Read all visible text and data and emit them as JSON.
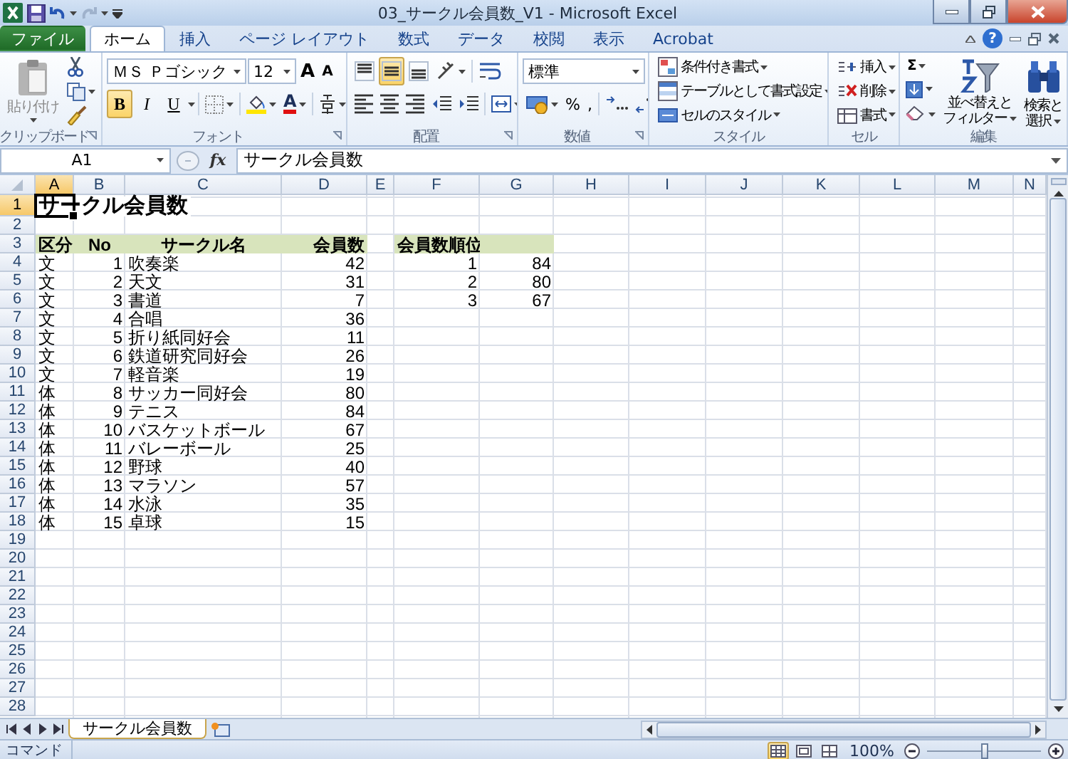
{
  "window": {
    "title": "03_サークル会員数_V1 - Microsoft Excel",
    "help": "?"
  },
  "ribbon_tabs": [
    {
      "label": "ファイル",
      "kind": "file",
      "selected": false
    },
    {
      "label": "ホーム",
      "kind": "tab",
      "selected": true
    },
    {
      "label": "挿入",
      "kind": "tab",
      "selected": false
    },
    {
      "label": "ページ レイアウト",
      "kind": "tab",
      "selected": false
    },
    {
      "label": "数式",
      "kind": "tab",
      "selected": false
    },
    {
      "label": "データ",
      "kind": "tab",
      "selected": false
    },
    {
      "label": "校閲",
      "kind": "tab",
      "selected": false
    },
    {
      "label": "表示",
      "kind": "tab",
      "selected": false
    },
    {
      "label": "Acrobat",
      "kind": "tab",
      "selected": false
    }
  ],
  "ribbon": {
    "clipboard": {
      "label": "クリップボード",
      "paste": "貼り付け"
    },
    "font": {
      "label": "フォント",
      "font_name": "ＭＳ Ｐゴシック",
      "font_size": "12",
      "grow": "A",
      "shrink": "A",
      "font_color": "A",
      "toggles": [
        {
          "label": "B",
          "on": true
        },
        {
          "label": "I",
          "on": false
        },
        {
          "label": "U",
          "on": false
        }
      ]
    },
    "alignment": {
      "label": "配置",
      "vertical": [
        {
          "on": false
        },
        {
          "on": true
        },
        {
          "on": false
        }
      ]
    },
    "number": {
      "label": "数値",
      "format": "標準",
      "percent": "%",
      "comma": ","
    },
    "styles": {
      "label": "スタイル",
      "items": [
        "条件付き書式",
        "テーブルとして書式設定",
        "セルのスタイル"
      ]
    },
    "cells": {
      "label": "セル",
      "items": [
        "挿入",
        "削除",
        "書式"
      ]
    },
    "editing": {
      "label": "編集",
      "sum": "Σ",
      "sort_filter": [
        "並べ替えと",
        "フィルター"
      ],
      "find_select": [
        "検索と",
        "選択"
      ]
    }
  },
  "formula_bar": {
    "name_box": "A1",
    "function_label": "fx",
    "formula": "サークル会員数"
  },
  "sheet": {
    "columns": [
      {
        "label": "A",
        "selected": true
      },
      {
        "label": "B",
        "selected": false
      },
      {
        "label": "C",
        "selected": false
      },
      {
        "label": "D",
        "selected": false
      },
      {
        "label": "E",
        "selected": false
      },
      {
        "label": "F",
        "selected": false
      },
      {
        "label": "G",
        "selected": false
      },
      {
        "label": "H",
        "selected": false
      },
      {
        "label": "I",
        "selected": false
      },
      {
        "label": "J",
        "selected": false
      },
      {
        "label": "K",
        "selected": false
      },
      {
        "label": "L",
        "selected": false
      },
      {
        "label": "M",
        "selected": false
      },
      {
        "label": "N",
        "selected": false
      }
    ],
    "rows": [
      {
        "label": "1",
        "selected": true,
        "cells": [
          {
            "text": "サークル会員数",
            "kind": "title",
            "active": true
          }
        ]
      },
      {
        "label": "2",
        "selected": false
      },
      {
        "label": "3",
        "selected": false,
        "cells": [
          {
            "text": "区分",
            "kind": "header"
          },
          {
            "text": "No",
            "kind": "header"
          },
          {
            "text": "サークル名",
            "kind": "header"
          },
          {
            "text": "会員数",
            "kind": "header"
          },
          null,
          {
            "text": "会員数順位",
            "kind": "header"
          },
          {
            "kind": "header"
          }
        ]
      },
      {
        "label": "4",
        "selected": false,
        "cells": [
          {
            "text": "文",
            "kind": "text"
          },
          {
            "text": "1",
            "kind": "number"
          },
          {
            "text": "吹奏楽",
            "kind": "text"
          },
          {
            "text": "42",
            "kind": "number"
          },
          null,
          {
            "text": "1",
            "kind": "number"
          },
          {
            "text": "84",
            "kind": "number"
          }
        ]
      },
      {
        "label": "5",
        "selected": false,
        "cells": [
          {
            "text": "文",
            "kind": "text"
          },
          {
            "text": "2",
            "kind": "number"
          },
          {
            "text": "天文",
            "kind": "text"
          },
          {
            "text": "31",
            "kind": "number"
          },
          null,
          {
            "text": "2",
            "kind": "number"
          },
          {
            "text": "80",
            "kind": "number"
          }
        ]
      },
      {
        "label": "6",
        "selected": false,
        "cells": [
          {
            "text": "文",
            "kind": "text"
          },
          {
            "text": "3",
            "kind": "number"
          },
          {
            "text": "書道",
            "kind": "text"
          },
          {
            "text": "7",
            "kind": "number"
          },
          null,
          {
            "text": "3",
            "kind": "number"
          },
          {
            "text": "67",
            "kind": "number"
          }
        ]
      },
      {
        "label": "7",
        "selected": false,
        "cells": [
          {
            "text": "文",
            "kind": "text"
          },
          {
            "text": "4",
            "kind": "number"
          },
          {
            "text": "合唱",
            "kind": "text"
          },
          {
            "text": "36",
            "kind": "number"
          }
        ]
      },
      {
        "label": "8",
        "selected": false,
        "cells": [
          {
            "text": "文",
            "kind": "text"
          },
          {
            "text": "5",
            "kind": "number"
          },
          {
            "text": "折り紙同好会",
            "kind": "text"
          },
          {
            "text": "11",
            "kind": "number"
          }
        ]
      },
      {
        "label": "9",
        "selected": false,
        "cells": [
          {
            "text": "文",
            "kind": "text"
          },
          {
            "text": "6",
            "kind": "number"
          },
          {
            "text": "鉄道研究同好会",
            "kind": "text"
          },
          {
            "text": "26",
            "kind": "number"
          }
        ]
      },
      {
        "label": "10",
        "selected": false,
        "cells": [
          {
            "text": "文",
            "kind": "text"
          },
          {
            "text": "7",
            "kind": "number"
          },
          {
            "text": "軽音楽",
            "kind": "text"
          },
          {
            "text": "19",
            "kind": "number"
          }
        ]
      },
      {
        "label": "11",
        "selected": false,
        "cells": [
          {
            "text": "体",
            "kind": "text"
          },
          {
            "text": "8",
            "kind": "number"
          },
          {
            "text": "サッカー同好会",
            "kind": "text"
          },
          {
            "text": "80",
            "kind": "number"
          }
        ]
      },
      {
        "label": "12",
        "selected": false,
        "cells": [
          {
            "text": "体",
            "kind": "text"
          },
          {
            "text": "9",
            "kind": "number"
          },
          {
            "text": "テニス",
            "kind": "text"
          },
          {
            "text": "84",
            "kind": "number"
          }
        ]
      },
      {
        "label": "13",
        "selected": false,
        "cells": [
          {
            "text": "体",
            "kind": "text"
          },
          {
            "text": "10",
            "kind": "number"
          },
          {
            "text": "バスケットボール",
            "kind": "text"
          },
          {
            "text": "67",
            "kind": "number"
          }
        ]
      },
      {
        "label": "14",
        "selected": false,
        "cells": [
          {
            "text": "体",
            "kind": "text"
          },
          {
            "text": "11",
            "kind": "number"
          },
          {
            "text": "バレーボール",
            "kind": "text"
          },
          {
            "text": "25",
            "kind": "number"
          }
        ]
      },
      {
        "label": "15",
        "selected": false,
        "cells": [
          {
            "text": "体",
            "kind": "text"
          },
          {
            "text": "12",
            "kind": "number"
          },
          {
            "text": "野球",
            "kind": "text"
          },
          {
            "text": "40",
            "kind": "number"
          }
        ]
      },
      {
        "label": "16",
        "selected": false,
        "cells": [
          {
            "text": "体",
            "kind": "text"
          },
          {
            "text": "13",
            "kind": "number"
          },
          {
            "text": "マラソン",
            "kind": "text"
          },
          {
            "text": "57",
            "kind": "number"
          }
        ]
      },
      {
        "label": "17",
        "selected": false,
        "cells": [
          {
            "text": "体",
            "kind": "text"
          },
          {
            "text": "14",
            "kind": "number"
          },
          {
            "text": "水泳",
            "kind": "text"
          },
          {
            "text": "35",
            "kind": "number"
          }
        ]
      },
      {
        "label": "18",
        "selected": false,
        "cells": [
          {
            "text": "体",
            "kind": "text"
          },
          {
            "text": "15",
            "kind": "number"
          },
          {
            "text": "卓球",
            "kind": "text"
          },
          {
            "text": "15",
            "kind": "number"
          }
        ]
      },
      {
        "label": "19",
        "selected": false
      },
      {
        "label": "20",
        "selected": false
      },
      {
        "label": "21",
        "selected": false
      },
      {
        "label": "22",
        "selected": false
      },
      {
        "label": "23",
        "selected": false
      },
      {
        "label": "24",
        "selected": false
      },
      {
        "label": "25",
        "selected": false
      },
      {
        "label": "26",
        "selected": false
      },
      {
        "label": "27",
        "selected": false
      },
      {
        "label": "28",
        "selected": false
      }
    ]
  },
  "sheet_tabs": [
    {
      "label": "サークル会員数",
      "selected": true
    }
  ],
  "status_bar": {
    "mode": "コマンド",
    "views": [
      {
        "selected": true
      },
      {
        "selected": false
      },
      {
        "selected": false
      }
    ],
    "zoom": "100%",
    "zoom_slider": {
      "level": 0.5
    }
  }
}
